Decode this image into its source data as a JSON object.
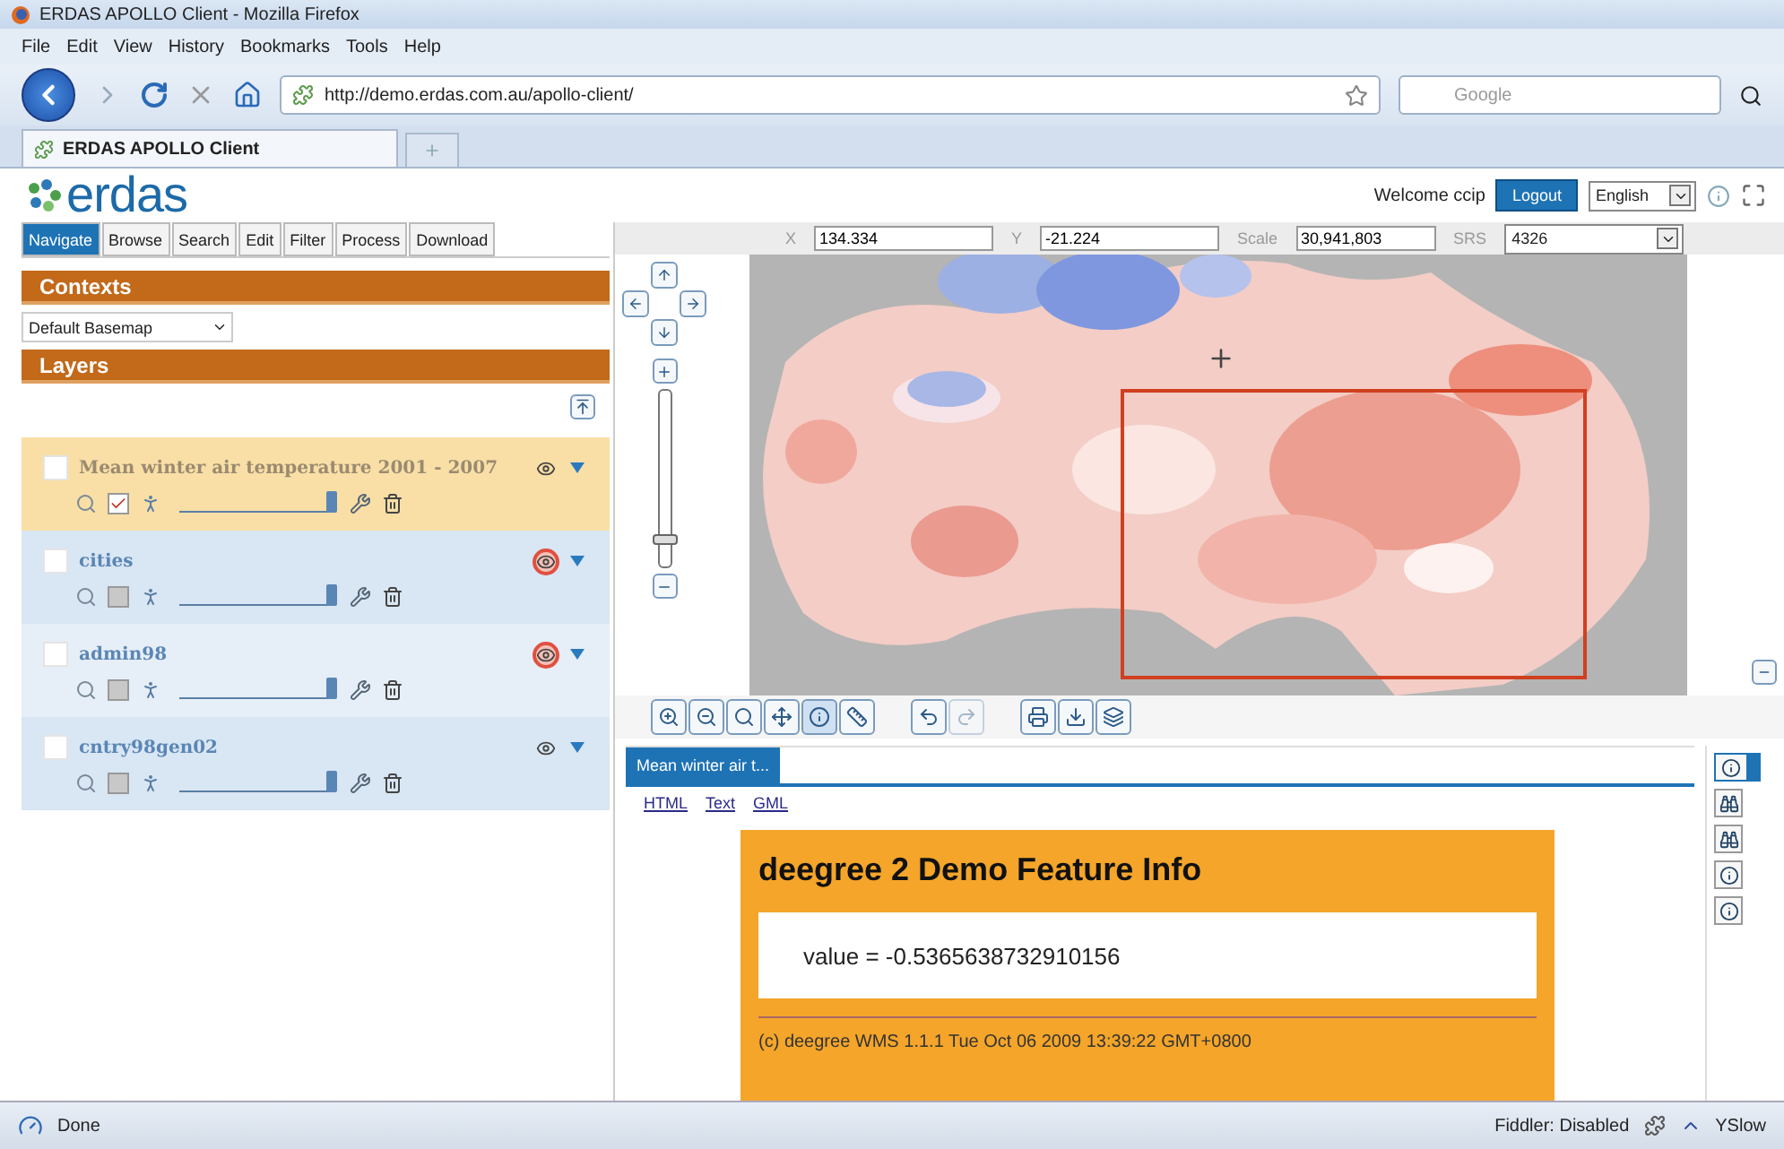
{
  "window": {
    "title": "ERDAS APOLLO Client - Mozilla Firefox"
  },
  "menu_bar": [
    "File",
    "Edit",
    "View",
    "History",
    "Bookmarks",
    "Tools",
    "Help"
  ],
  "nav_bar": {
    "url": "http://demo.erdas.com.au/apollo-client/",
    "search_placeholder": "Google"
  },
  "browser_tabs": [
    {
      "label": "ERDAS APOLLO Client",
      "selected": true
    }
  ],
  "app": {
    "logo": "erdas",
    "welcome": "Welcome ccip",
    "logout": "Logout",
    "language": "English"
  },
  "app_tabs": [
    {
      "label": "Navigate",
      "selected": true
    },
    {
      "label": "Browse",
      "selected": false
    },
    {
      "label": "Search",
      "selected": false
    },
    {
      "label": "Edit",
      "selected": false
    },
    {
      "label": "Filter",
      "selected": false
    },
    {
      "label": "Process",
      "selected": false
    },
    {
      "label": "Download",
      "selected": false
    }
  ],
  "contexts": {
    "header": "Contexts",
    "value": "Default Basemap"
  },
  "layers": {
    "header": "Layers",
    "items": [
      {
        "name": "Mean winter air temperature 2001 - 2007",
        "selected": true,
        "visibility_alert": false,
        "query_checked": true,
        "level": 1
      },
      {
        "name": "cities",
        "selected": false,
        "visibility_alert": true,
        "query_checked": false,
        "level": 1
      },
      {
        "name": "admin98",
        "selected": false,
        "visibility_alert": true,
        "query_checked": false,
        "level": 1
      },
      {
        "name": "cntry98gen02",
        "selected": false,
        "visibility_alert": false,
        "query_checked": false,
        "level": 1
      }
    ]
  },
  "coordinates": [
    {
      "label": "X",
      "value": "134.334"
    },
    {
      "label": "Y",
      "value": "-21.224"
    },
    {
      "label": "Scale",
      "value": "30,941,803"
    },
    {
      "label": "SRS",
      "value": "4326",
      "kind": "select"
    }
  ],
  "map": {
    "zoom_slider": {
      "level": 0.15
    }
  },
  "toolbar": {
    "groups": [
      [
        {
          "kind": "zoom-in",
          "selected": false,
          "disabled": false
        },
        {
          "kind": "zoom-out",
          "selected": false,
          "disabled": false
        },
        {
          "kind": "zoom-box",
          "selected": false,
          "disabled": false
        },
        {
          "kind": "pan",
          "selected": false,
          "disabled": false
        },
        {
          "kind": "info",
          "selected": true,
          "disabled": false
        },
        {
          "kind": "measure",
          "selected": false,
          "disabled": false
        }
      ],
      [
        {
          "kind": "undo",
          "selected": false,
          "disabled": false
        },
        {
          "kind": "redo",
          "selected": false,
          "disabled": true
        }
      ],
      [
        {
          "kind": "print",
          "selected": false,
          "disabled": false
        },
        {
          "kind": "export",
          "selected": false,
          "disabled": false
        },
        {
          "kind": "layers",
          "selected": false,
          "disabled": false
        }
      ]
    ]
  },
  "feature_info": {
    "tabs": [
      {
        "label": "Mean winter air t...",
        "selected": true
      }
    ],
    "links": [
      "HTML",
      "Text",
      "GML"
    ],
    "title": "deegree 2 Demo Feature Info",
    "value": "value = -0.5365638732910156",
    "footer": "(c) deegree WMS 1.1.1 Tue Oct 06 2009 13:39:22 GMT+0800"
  },
  "side_buttons": [
    {
      "kind": "info",
      "selected": true
    },
    {
      "kind": "binoculars",
      "selected": false
    },
    {
      "kind": "binoculars",
      "selected": false
    },
    {
      "kind": "info",
      "selected": false
    },
    {
      "kind": "info",
      "selected": false
    }
  ],
  "status_bar": {
    "text": "Done",
    "fiddler": "Fiddler: Disabled",
    "yslow": "YSlow"
  }
}
